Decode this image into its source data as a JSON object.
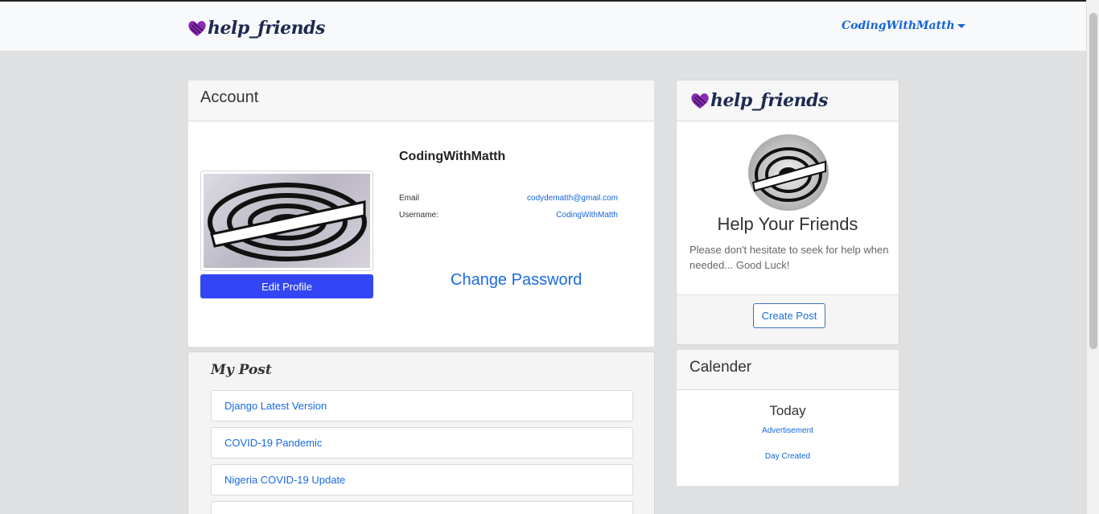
{
  "navbar": {
    "brand": "help_friends",
    "user": "CodingWithMatth"
  },
  "account": {
    "header": "Account",
    "edit_label": "Edit Profile",
    "name": "CodingWithMatth",
    "email_label": "Email",
    "email_value": "codydematth@gmail.com",
    "username_label": "Username:",
    "username_value": "CodingWithMatth",
    "change_password": "Change Password"
  },
  "my_post": {
    "title": "My Post",
    "items": [
      "Django Latest Version",
      "COVID-19 Pandemic",
      "Nigeria COVID-19 Update",
      ""
    ]
  },
  "help": {
    "brand": "help_friends",
    "title": "Help Your Friends",
    "text": "Please don't hesitate to seek for help when needed... Good Luck!",
    "create_label": "Create Post"
  },
  "calendar": {
    "header": "Calender",
    "today": "Today",
    "link1": "Advertisement",
    "link2": "Day Created"
  },
  "colors": {
    "primary": "#3346f5",
    "link": "#1a6ae0",
    "brand_heart": "#8b2bb5",
    "brand_text": "#1d2b4f"
  }
}
